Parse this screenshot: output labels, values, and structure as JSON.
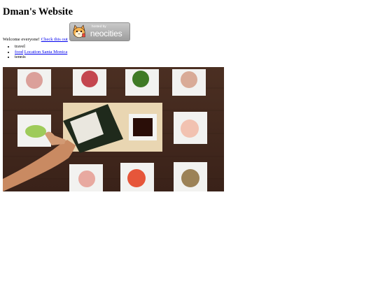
{
  "page": {
    "title": "Dman's Website",
    "welcome_text": "Welcome everyone!",
    "welcome_link": "Check this out"
  },
  "badge": {
    "line1": "hosted by",
    "line2": "neocities",
    "icon": "neocities-cat-icon"
  },
  "list": {
    "items": [
      {
        "text": "travel"
      },
      {
        "link1": "food",
        "link2": "Location Santa Monica"
      },
      {
        "text": "tennis"
      }
    ]
  },
  "photo": {
    "description_icon": "sushi-hand-roll-photo"
  }
}
